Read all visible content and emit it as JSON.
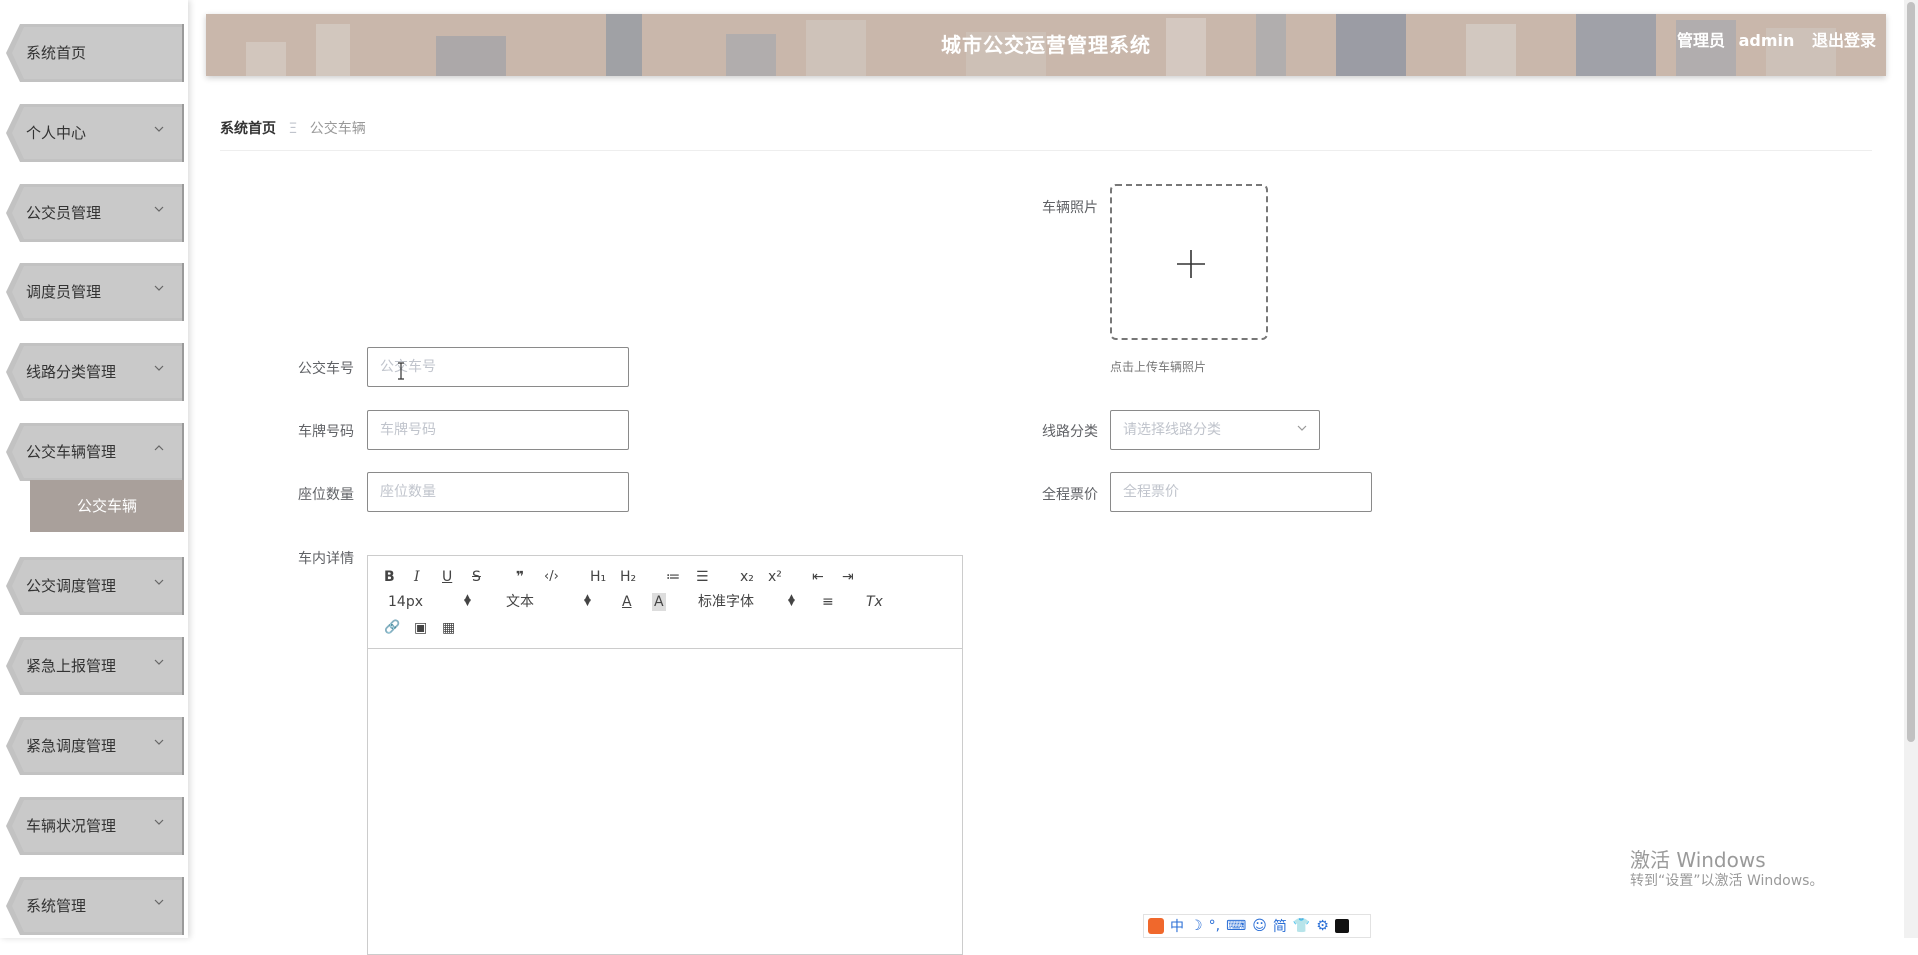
{
  "header": {
    "title": "城市公交运营管理系统",
    "role": "管理员",
    "username": "admin",
    "logout": "退出登录"
  },
  "sidebar": {
    "items": [
      {
        "label": "系统首页",
        "has_arrow": false
      },
      {
        "label": "个人中心",
        "has_arrow": true
      },
      {
        "label": "公交员管理",
        "has_arrow": true
      },
      {
        "label": "调度员管理",
        "has_arrow": true
      },
      {
        "label": "线路分类管理",
        "has_arrow": true
      },
      {
        "label": "公交车辆管理",
        "has_arrow": true,
        "expanded": true
      },
      {
        "label": "公交调度管理",
        "has_arrow": true
      },
      {
        "label": "紧急上报管理",
        "has_arrow": true
      },
      {
        "label": "紧急调度管理",
        "has_arrow": true
      },
      {
        "label": "车辆状况管理",
        "has_arrow": true
      },
      {
        "label": "系统管理",
        "has_arrow": true
      }
    ],
    "active_subitem": "公交车辆"
  },
  "breadcrumb": {
    "home": "系统首页",
    "separator": "Ξ",
    "current": "公交车辆"
  },
  "form": {
    "photo_label": "车辆照片",
    "photo_hint": "点击上传车辆照片",
    "bus_no_label": "公交车号",
    "bus_no_placeholder": "公交车号",
    "plate_label": "车牌号码",
    "plate_placeholder": "车牌号码",
    "route_label": "线路分类",
    "route_placeholder": "请选择线路分类",
    "seats_label": "座位数量",
    "seats_placeholder": "座位数量",
    "fare_label": "全程票价",
    "fare_placeholder": "全程票价",
    "details_label": "车内详情"
  },
  "editor": {
    "buttons": {
      "bold": "B",
      "italic": "I",
      "underline": "U",
      "strike": "S",
      "quote": "❞",
      "code": "‹/›",
      "h1": "H₁",
      "h2": "H₂",
      "ordered_list": "≔",
      "bullet_list": "☰",
      "subscript": "x₂",
      "superscript": "x²",
      "outdent": "⇤",
      "indent": "⇥",
      "font_color": "A",
      "background": "A",
      "align": "≡",
      "clean": "Tx",
      "link": "🔗",
      "image": "▣",
      "video": "▦"
    },
    "font_size": "14px",
    "header_type": "文本",
    "font_family": "标准字体"
  },
  "watermark": {
    "line1": "激活 Windows",
    "line2": "转到“设置”以激活 Windows。"
  },
  "ime": {
    "items": [
      "中",
      "☽",
      "°,",
      "⌨",
      "☺",
      "简",
      "👕",
      "⚙"
    ]
  },
  "colors": {
    "sidebar_item": "#c9c9c9",
    "submenu_active": "#a9a09b",
    "header_bg": "#c8b6aa"
  }
}
